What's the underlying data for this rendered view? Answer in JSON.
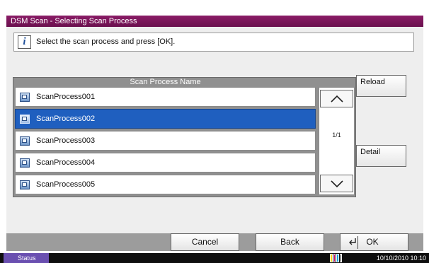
{
  "window": {
    "title": "DSM Scan - Selecting Scan Process"
  },
  "info": {
    "icon": "info-icon",
    "message": "Select the scan process and press [OK]."
  },
  "list": {
    "header": "Scan Process Name",
    "items": [
      {
        "label": "ScanProcess001",
        "icon": "scan-process-icon",
        "selected": false
      },
      {
        "label": "ScanProcess002",
        "icon": "scan-process-icon",
        "selected": true
      },
      {
        "label": "ScanProcess003",
        "icon": "scan-process-icon",
        "selected": false
      },
      {
        "label": "ScanProcess004",
        "icon": "scan-process-icon",
        "selected": false
      },
      {
        "label": "ScanProcess005",
        "icon": "scan-process-icon",
        "selected": false
      }
    ],
    "page_indicator": "1/1"
  },
  "side_buttons": {
    "reload": "Reload",
    "detail": "Detail"
  },
  "footer": {
    "cancel": "Cancel",
    "back": "Back",
    "ok": "OK"
  },
  "status_bar": {
    "status": "Status",
    "datetime": "10/10/2010  10:10",
    "toner_colors": [
      "#ffd400",
      "#e0007a",
      "#00a0e0",
      "#111111"
    ]
  },
  "colors": {
    "title_bar": "#7a145a",
    "selected_row": "#1f5fbf",
    "status_button": "#6a4fb0"
  }
}
